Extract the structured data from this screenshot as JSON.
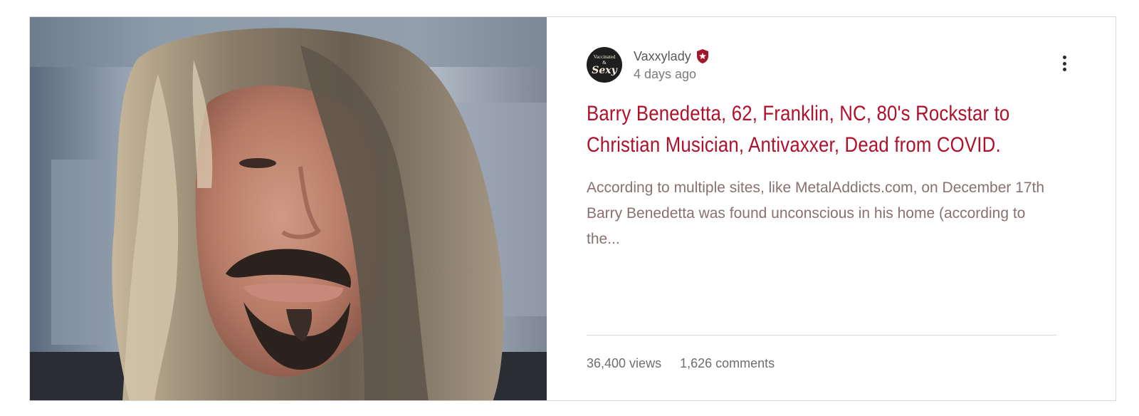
{
  "post": {
    "author": {
      "name": "Vaxxylady",
      "time": "4 days ago",
      "avatar_text_top": "Vaccinated",
      "avatar_text_amp": "&",
      "avatar_text_bottom": "Sexy",
      "badge_icon": "admin-star-badge-icon"
    },
    "title": "Barry Benedetta, 62, Franklin, NC, 80's Rockstar to Christian Musician, Antivaxxer, Dead from COVID.",
    "excerpt": "According to multiple sites, like MetalAddicts.com, on December 17th Barry Benedetta was found unconscious in his home (according to the...",
    "stats": {
      "views": "36,400 views",
      "comments": "1,626 comments"
    },
    "menu_icon": "more-vertical-icon"
  },
  "colors": {
    "title": "#b0112a",
    "badge": "#a3172d",
    "excerpt": "#8a7070"
  }
}
